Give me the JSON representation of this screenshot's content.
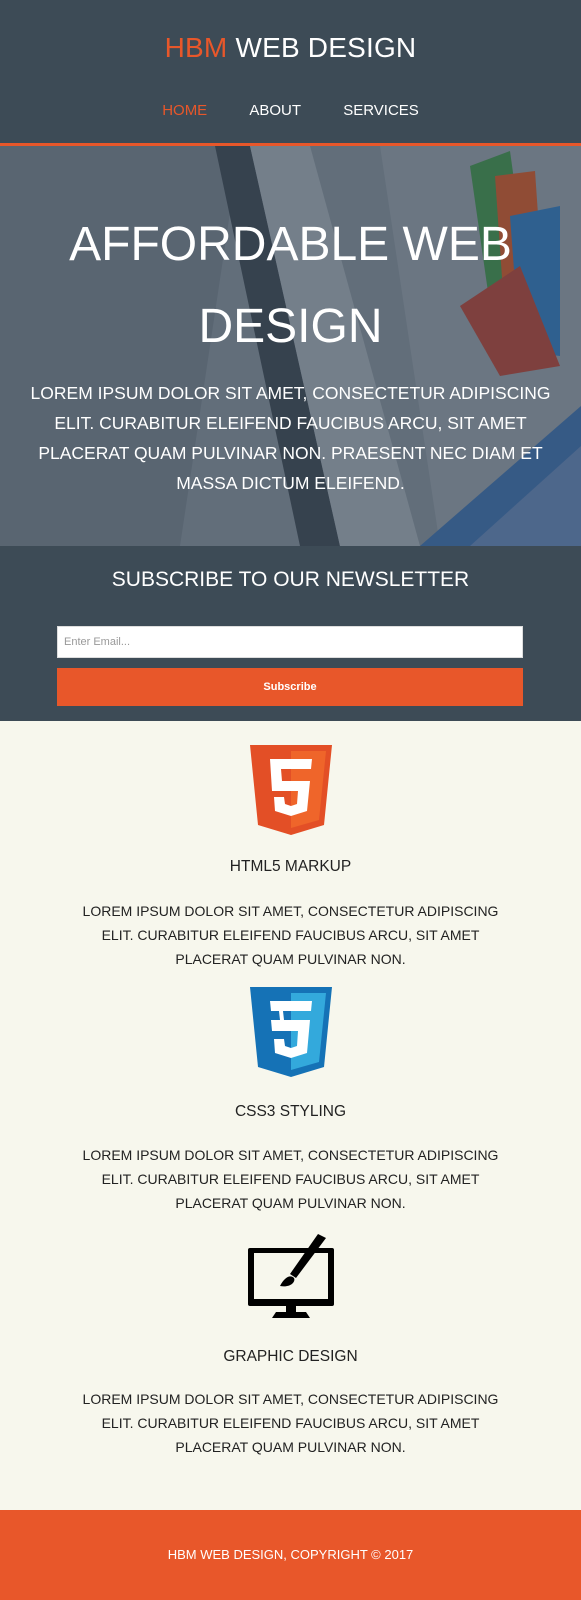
{
  "header": {
    "brand_highlight": "HBM",
    "brand_rest": "WEB DESIGN",
    "nav": [
      {
        "label": "HOME",
        "active": true
      },
      {
        "label": "ABOUT",
        "active": false
      },
      {
        "label": "SERVICES",
        "active": false
      }
    ]
  },
  "hero": {
    "title": "AFFORDABLE WEB DESIGN",
    "text": "LOREM IPSUM DOLOR SIT AMET, CONSECTETUR ADIPISCING ELIT. CURABITUR ELEIFEND FAUCIBUS ARCU, SIT AMET PLACERAT QUAM PULVINAR NON. PRAESENT NEC DIAM ET MASSA DICTUM ELEIFEND."
  },
  "newsletter": {
    "heading": "SUBSCRIBE TO OUR NEWSLETTER",
    "email_placeholder": "Enter Email...",
    "email_value": "",
    "button_label": "Subscribe"
  },
  "features": [
    {
      "icon": "html5-icon",
      "title": "HTML5 MARKUP",
      "text": "LOREM IPSUM DOLOR SIT AMET, CONSECTETUR ADIPISCING ELIT. CURABITUR ELEIFEND FAUCIBUS ARCU, SIT AMET PLACERAT QUAM PULVINAR NON."
    },
    {
      "icon": "css3-icon",
      "title": "CSS3 STYLING",
      "text": "LOREM IPSUM DOLOR SIT AMET, CONSECTETUR ADIPISCING ELIT. CURABITUR ELEIFEND FAUCIBUS ARCU, SIT AMET PLACERAT QUAM PULVINAR NON."
    },
    {
      "icon": "graphic-design-icon",
      "title": "GRAPHIC DESIGN",
      "text": "LOREM IPSUM DOLOR SIT AMET, CONSECTETUR ADIPISCING ELIT. CURABITUR ELEIFEND FAUCIBUS ARCU, SIT AMET PLACERAT QUAM PULVINAR NON."
    }
  ],
  "footer": {
    "text": "HBM WEB DESIGN, COPYRIGHT © 2017"
  },
  "colors": {
    "accent": "#e8572a",
    "dark": "#3d4b56",
    "background": "#f7f7ed"
  }
}
